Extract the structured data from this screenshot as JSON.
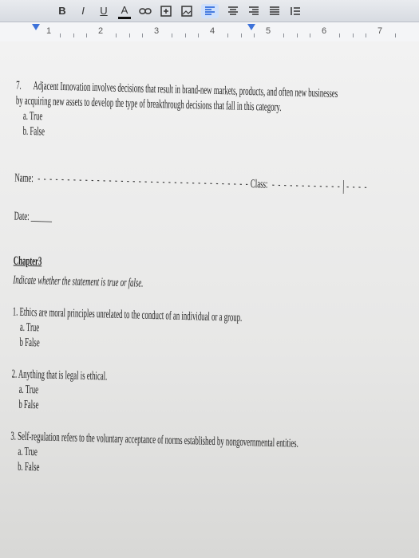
{
  "toolbar": {
    "format_items": [
      "B",
      "I",
      "U",
      "A"
    ],
    "icons": [
      "link-icon",
      "insert-comment-icon",
      "image-icon",
      "align-left-icon",
      "align-center-icon",
      "align-right-icon",
      "align-justify-icon",
      "line-spacing-icon"
    ]
  },
  "ruler": {
    "numbers": [
      "1",
      "2",
      "3",
      "4",
      "5",
      "6",
      "7"
    ]
  },
  "document": {
    "q7_number": "7.",
    "q7_line1": "Adjacent Innovation involves decisions that result in brand-new markets, products, and often new businesses",
    "q7_line2": "by acquiring new assets to develop the type of breakthrough decisions that fall in this category.",
    "q7_option_a": "a. True",
    "q7_option_b": "b. False",
    "name_label": "Name:",
    "class_label": "Class:",
    "date_label": "Date:",
    "chapter_heading": "Chapter3",
    "instruction": "Indicate whether the statement is true or false.",
    "q1": "1. Ethics are moral principles unrelated to the conduct of an individual or a group.",
    "q1_a": "a. True",
    "q1_b": "b False",
    "q2": "2. Anything that is legal is ethical.",
    "q2_a": "a. True",
    "q2_b": "b False",
    "q3": "3. Self-regulation refers to the voluntary acceptance of norms established by nongovernmental entities.",
    "q3_a": "a. True",
    "q3_b": "b. False"
  }
}
